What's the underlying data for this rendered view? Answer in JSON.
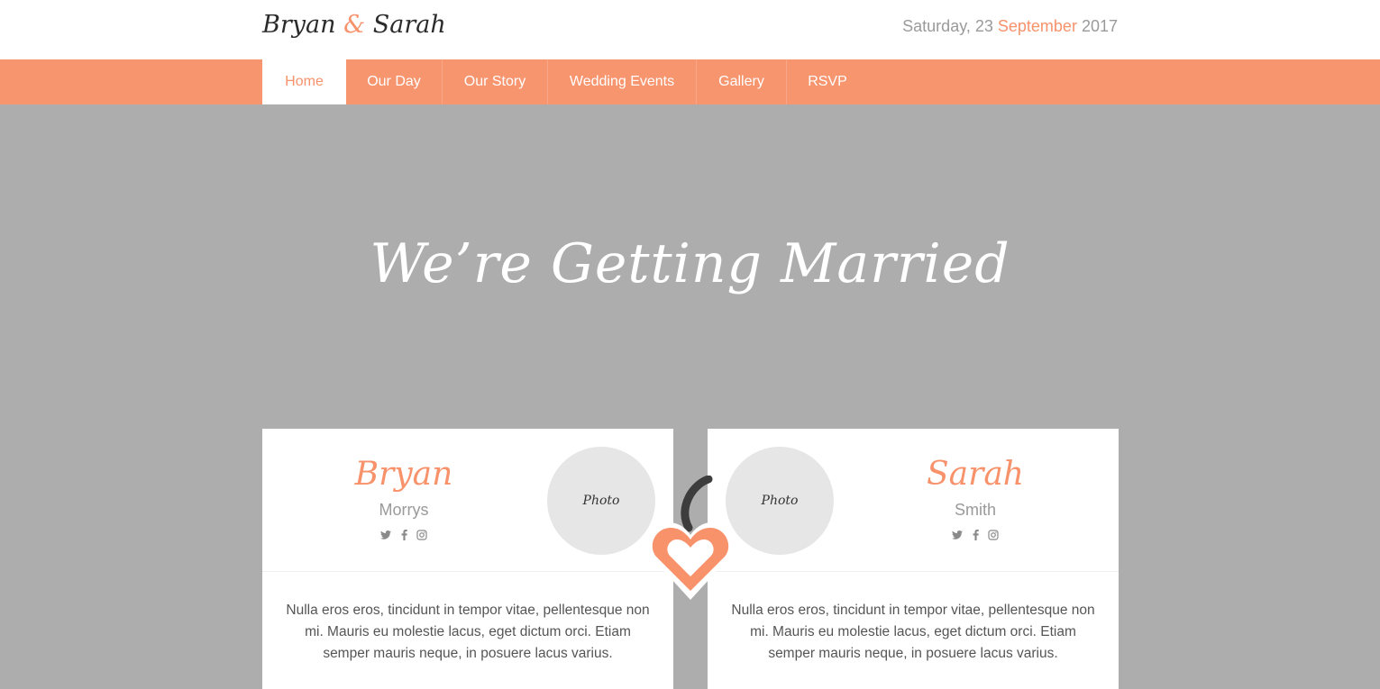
{
  "header": {
    "logo": {
      "first": "Bryan",
      "amp": "&",
      "second": "Sarah"
    },
    "date": {
      "prefix": "Saturday, 23 ",
      "month": "September",
      "year": " 2017"
    }
  },
  "nav": {
    "items": [
      {
        "label": "Home",
        "active": true
      },
      {
        "label": "Our Day"
      },
      {
        "label": "Our Story"
      },
      {
        "label": "Wedding Events"
      },
      {
        "label": "Gallery"
      },
      {
        "label": "RSVP"
      }
    ]
  },
  "hero": {
    "title": "We’re Getting Married"
  },
  "couple": {
    "groom": {
      "first_name": "Bryan",
      "last_name": "Morrys",
      "photo_label": "Photo",
      "bio": "Nulla eros eros, tincidunt in tempor vitae, pellentesque non mi. Mauris eu molestie lacus, eget dictum orci. Etiam semper mauris neque, in posuere lacus varius."
    },
    "bride": {
      "first_name": "Sarah",
      "last_name": "Smith",
      "photo_label": "Photo",
      "bio": "Nulla eros eros, tincidunt in tempor vitae, pellentesque non mi. Mauris eu molestie lacus, eget dictum orci. Etiam semper mauris neque, in posuere lacus varius."
    }
  },
  "icons": {
    "socials": [
      "twitter-icon",
      "facebook-icon",
      "instagram-icon"
    ],
    "center": "heart-icon"
  },
  "colors": {
    "accent": "#f7926b",
    "nav_bg": "#f7956f",
    "hero_bg": "#adadad",
    "text_muted": "#9a9a9a"
  }
}
